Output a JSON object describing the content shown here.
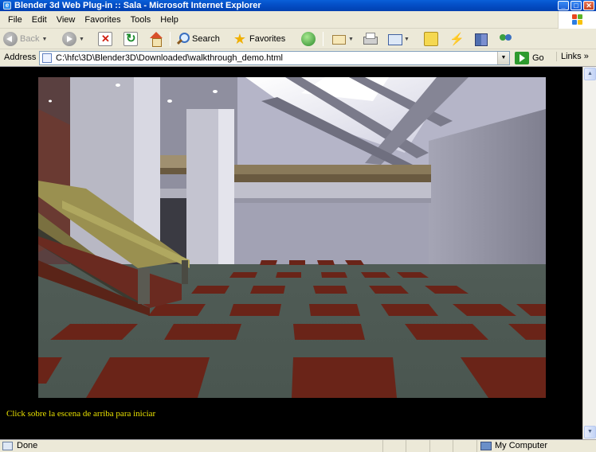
{
  "window": {
    "title": "Blender 3d Web Plug-in :: Sala - Microsoft Internet Explorer",
    "minimize": "_",
    "maximize": "□",
    "close": "✕"
  },
  "menu": {
    "items": [
      "File",
      "Edit",
      "View",
      "Favorites",
      "Tools",
      "Help"
    ]
  },
  "toolbar": {
    "back_label": "Back",
    "search_label": "Search",
    "favorites_label": "Favorites"
  },
  "address": {
    "label": "Address",
    "url": "C:\\hfc\\3D\\Blender3D\\Downloaded\\walkthrough_demo.html",
    "go_label": "Go",
    "links_label": "Links"
  },
  "page": {
    "caption": "Click sobre la escena de arriba para iniciar"
  },
  "status": {
    "text": "Done",
    "zone": "My Computer"
  },
  "colors": {
    "caption": "#e8e000",
    "background": "#000000",
    "floor": "#4e5a52",
    "tile": "#6a2418"
  }
}
